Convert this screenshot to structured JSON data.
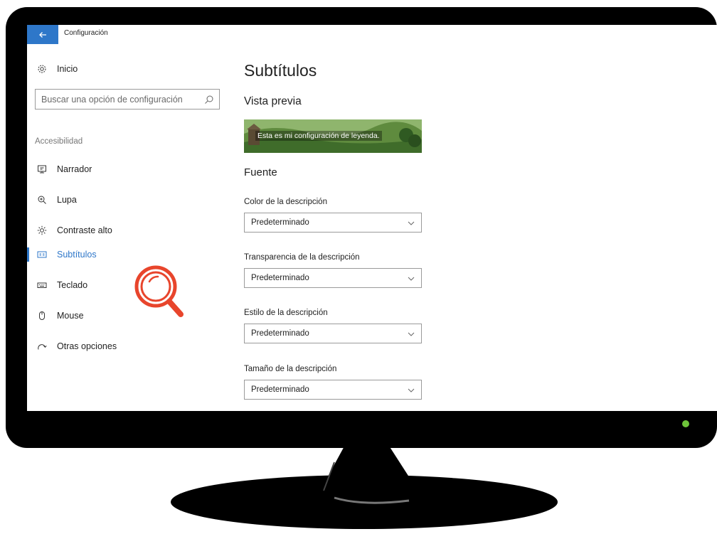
{
  "window": {
    "title": "Configuración"
  },
  "sidebar": {
    "home_label": "Inicio",
    "search_placeholder": "Buscar una opción de configuración",
    "section_label": "Accesibilidad",
    "items": [
      {
        "label": "Narrador",
        "icon": "narrator-icon",
        "active": false
      },
      {
        "label": "Lupa",
        "icon": "magnifier-icon",
        "active": false
      },
      {
        "label": "Contraste alto",
        "icon": "brightness-icon",
        "active": false
      },
      {
        "label": "Subtítulos",
        "icon": "closed-captions-icon",
        "active": true
      },
      {
        "label": "Teclado",
        "icon": "keyboard-icon",
        "active": false
      },
      {
        "label": "Mouse",
        "icon": "mouse-icon",
        "active": false
      },
      {
        "label": "Otras opciones",
        "icon": "other-options-icon",
        "active": false
      }
    ]
  },
  "main": {
    "title": "Subtítulos",
    "preview_heading": "Vista previa",
    "preview_caption": "Esta es mi configuración de leyenda.",
    "font_heading": "Fuente",
    "fields": [
      {
        "label": "Color de la descripción",
        "value": "Predeterminado"
      },
      {
        "label": "Transparencia de la descripción",
        "value": "Predeterminado"
      },
      {
        "label": "Estilo de la descripción",
        "value": "Predeterminado"
      },
      {
        "label": "Tamaño de la descripción",
        "value": "Predeterminado"
      }
    ]
  },
  "colors": {
    "accent": "#2e77c9",
    "monitor": "#000000",
    "power_led": "#6ec43a",
    "magnifier_overlay": "#e8452c"
  }
}
